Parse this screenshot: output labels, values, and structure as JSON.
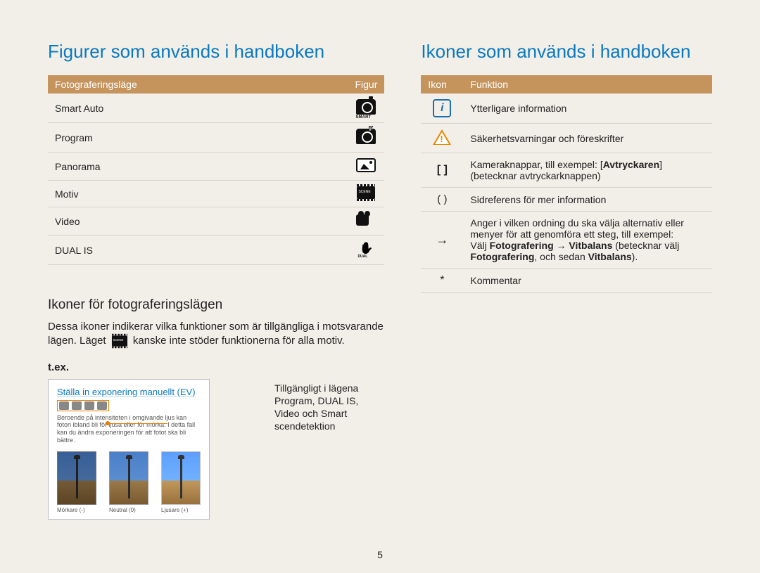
{
  "left": {
    "heading": "Figurer som används i handboken",
    "table": {
      "col1": "Fotograferingsläge",
      "col2": "Figur",
      "rows": [
        {
          "label": "Smart Auto",
          "icon": "smart-auto-icon"
        },
        {
          "label": "Program",
          "icon": "program-icon"
        },
        {
          "label": "Panorama",
          "icon": "panorama-icon"
        },
        {
          "label": "Motiv",
          "icon": "scene-icon"
        },
        {
          "label": "Video",
          "icon": "video-icon"
        },
        {
          "label": "DUAL IS",
          "icon": "dual-is-icon"
        }
      ]
    },
    "subheading": "Ikoner för fotograferingslägen",
    "body_pre": "Dessa ikoner indikerar vilka funktioner som är tillgängliga i motsvarande lägen. Läget ",
    "body_post": " kanske inte stöder funktionerna för alla motiv.",
    "tex": "t.ex.",
    "callout": {
      "title": "Ställa in exponering manuellt (EV)",
      "desc": "Beroende på intensiteten i omgivande ljus kan foton ibland bli för ljusa eller för mörka. I detta fall kan du ändra exponeringen för att fotot ska bli bättre.",
      "thumbs": [
        {
          "cap": "Mörkare (-)"
        },
        {
          "cap": "Neutral (0)"
        },
        {
          "cap": "Ljusare (+)"
        }
      ]
    },
    "callout_note": "Tillgängligt i lägena Program, DUAL IS, Video och Smart scendetektion"
  },
  "right": {
    "heading": "Ikoner som används i handboken",
    "table": {
      "col1": "Ikon",
      "col2": "Funktion",
      "rows": {
        "info": "Ytterligare information",
        "warn": "Säkerhetsvarningar och föreskrifter",
        "bracket_pre": "Kameraknappar, till exempel: [",
        "bracket_b": "Avtryckaren",
        "bracket_post": "] (betecknar avtryckarknappen)",
        "paren": "Sidreferens för mer information",
        "arrow_l1": "Anger i vilken ordning du ska välja alternativ eller menyer för att genomföra ett steg, till exempel:",
        "arrow_l2a": "Välj ",
        "arrow_l2b": "Fotografering → Vitbalans",
        "arrow_l2c": " (betecknar välj ",
        "arrow_l3a": "Fotografering",
        "arrow_l3b": ", och sedan ",
        "arrow_l3c": "Vitbalans",
        "arrow_l3d": ").",
        "star": "Kommentar"
      }
    }
  },
  "icon_symbols": {
    "bracket": "[  ]",
    "paren": "(  )",
    "arrow": "→",
    "star": "*"
  },
  "page_number": "5"
}
